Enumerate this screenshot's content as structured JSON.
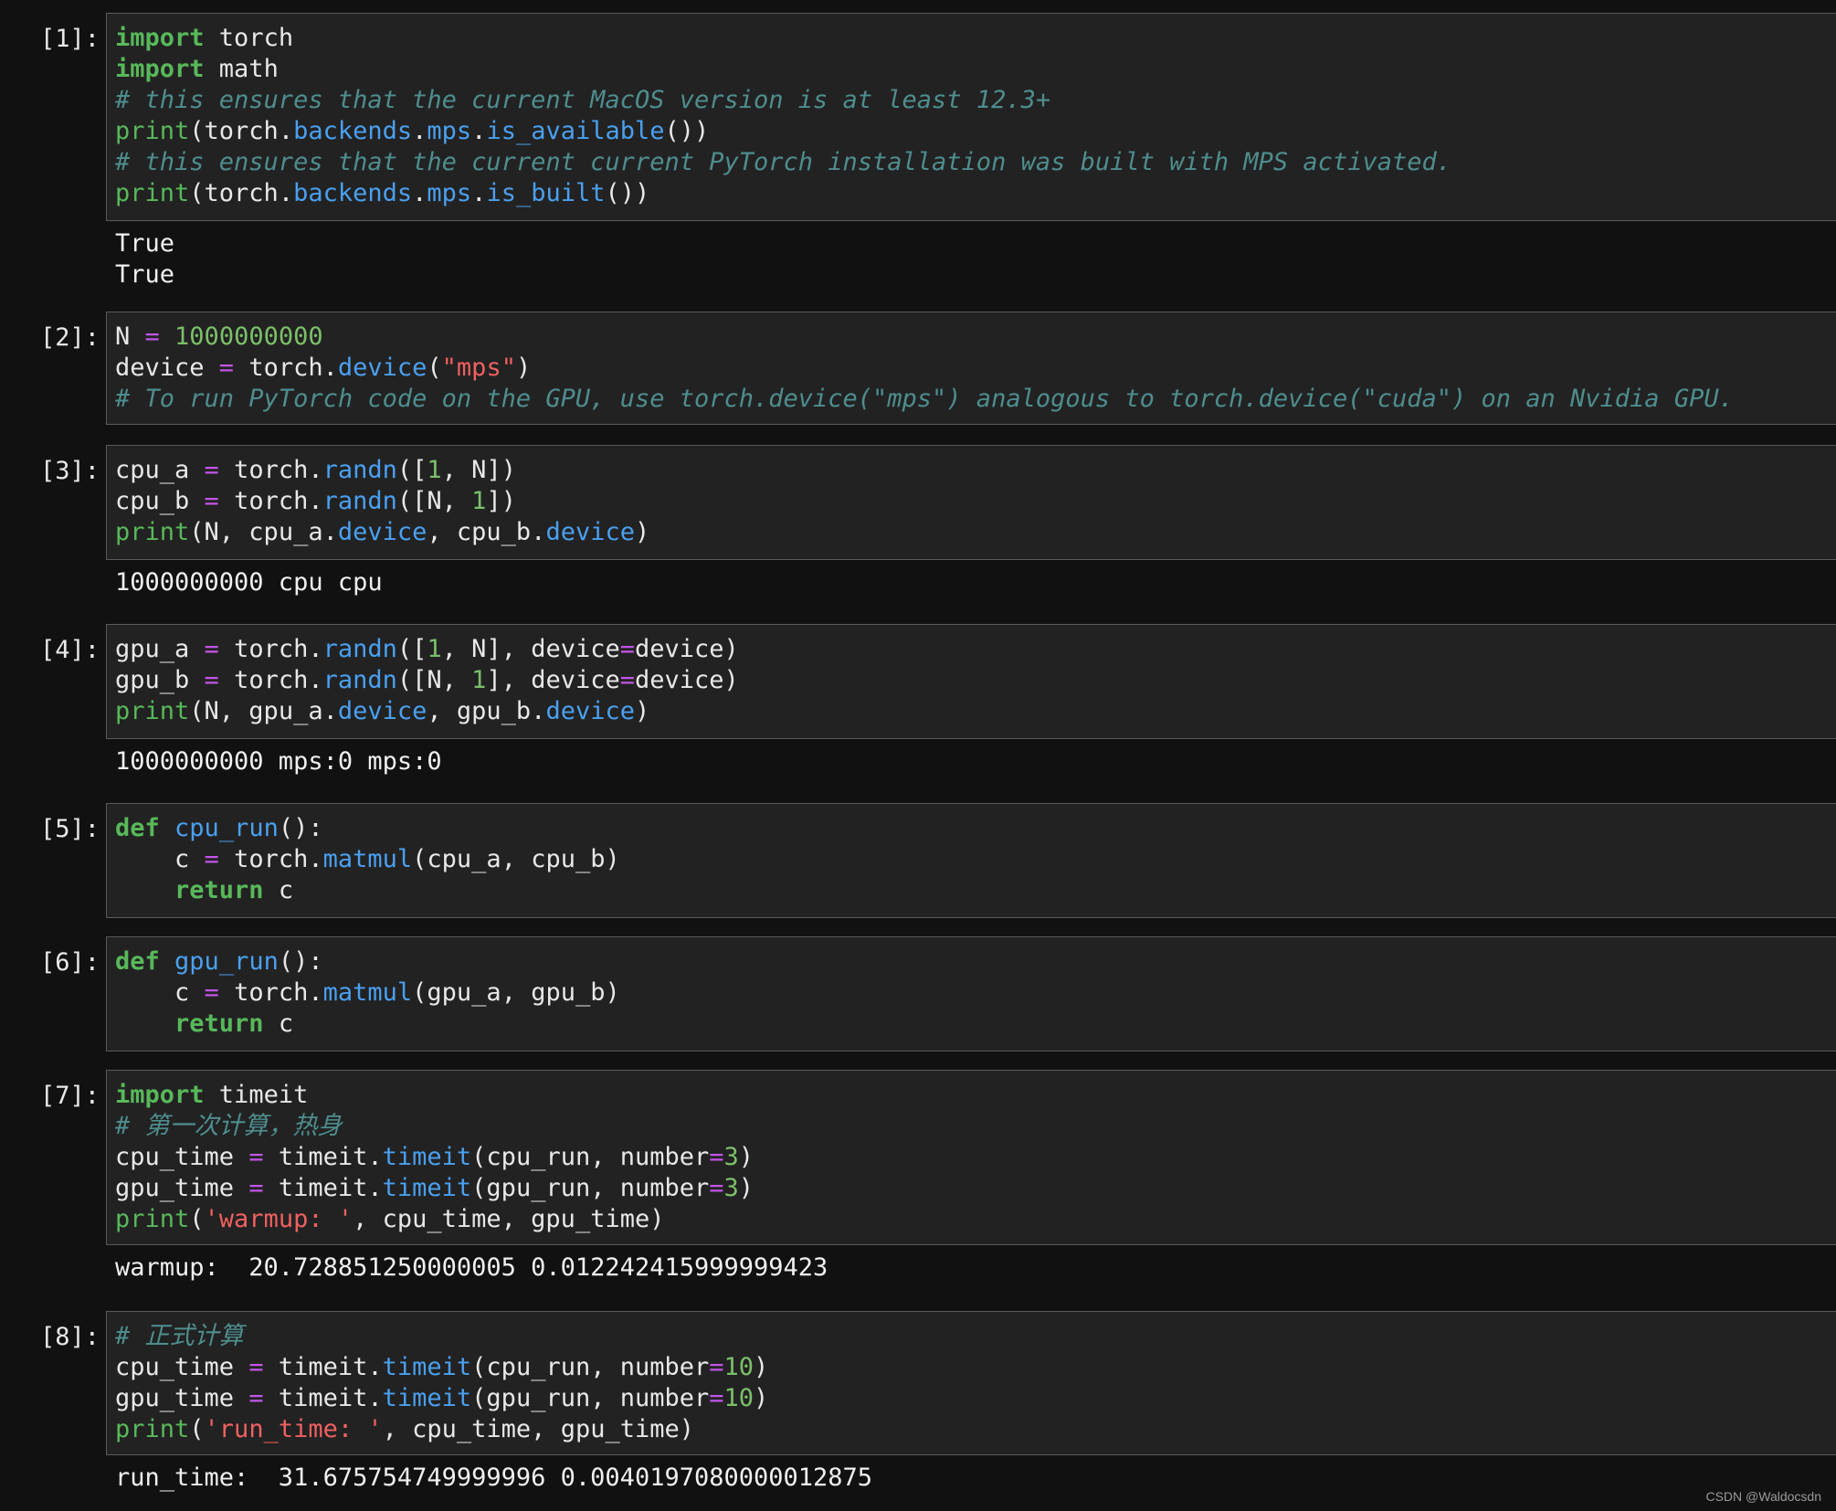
{
  "notebook": {
    "cells": [
      {
        "prompt": "[1]:",
        "code": [
          [
            [
              "kw",
              "import"
            ],
            [
              "t",
              " torch"
            ]
          ],
          [
            [
              "kw",
              "import"
            ],
            [
              "t",
              " math"
            ]
          ],
          [
            [
              "cm",
              "# this ensures that the current MacOS version is at least 12.3+"
            ]
          ],
          [
            [
              "bi",
              "print"
            ],
            [
              "t",
              "(torch."
            ],
            [
              "at",
              "backends"
            ],
            [
              "t",
              "."
            ],
            [
              "at",
              "mps"
            ],
            [
              "t",
              "."
            ],
            [
              "at",
              "is_available"
            ],
            [
              "t",
              "())"
            ]
          ],
          [
            [
              "cm",
              "# this ensures that the current current PyTorch installation was built with MPS activated."
            ]
          ],
          [
            [
              "bi",
              "print"
            ],
            [
              "t",
              "(torch."
            ],
            [
              "at",
              "backends"
            ],
            [
              "t",
              "."
            ],
            [
              "at",
              "mps"
            ],
            [
              "t",
              "."
            ],
            [
              "at",
              "is_built"
            ],
            [
              "t",
              "())"
            ]
          ]
        ],
        "output": [
          "True",
          "True"
        ]
      },
      {
        "prompt": "[2]:",
        "code": [
          [
            [
              "t",
              "N "
            ],
            [
              "op",
              "="
            ],
            [
              "t",
              " "
            ],
            [
              "nm",
              "1000000000"
            ]
          ],
          [
            [
              "t",
              "device "
            ],
            [
              "op",
              "="
            ],
            [
              "t",
              " torch."
            ],
            [
              "at",
              "device"
            ],
            [
              "t",
              "("
            ],
            [
              "st",
              "\"mps\""
            ],
            [
              "t",
              ")"
            ]
          ],
          [
            [
              "cm",
              "# To run PyTorch code on the GPU, use torch.device(\"mps\") analogous to torch.device(\"cuda\") on an Nvidia GPU."
            ]
          ]
        ],
        "output": []
      },
      {
        "prompt": "[3]:",
        "code": [
          [
            [
              "t",
              "cpu_a "
            ],
            [
              "op",
              "="
            ],
            [
              "t",
              " torch."
            ],
            [
              "at",
              "randn"
            ],
            [
              "t",
              "(["
            ],
            [
              "nm",
              "1"
            ],
            [
              "t",
              ", N])"
            ]
          ],
          [
            [
              "t",
              "cpu_b "
            ],
            [
              "op",
              "="
            ],
            [
              "t",
              " torch."
            ],
            [
              "at",
              "randn"
            ],
            [
              "t",
              "([N, "
            ],
            [
              "nm",
              "1"
            ],
            [
              "t",
              "])"
            ]
          ],
          [
            [
              "bi",
              "print"
            ],
            [
              "t",
              "(N, cpu_a."
            ],
            [
              "at",
              "device"
            ],
            [
              "t",
              ", cpu_b."
            ],
            [
              "at",
              "device"
            ],
            [
              "t",
              ")"
            ]
          ]
        ],
        "output": [
          "1000000000 cpu cpu"
        ]
      },
      {
        "prompt": "[4]:",
        "code": [
          [
            [
              "t",
              "gpu_a "
            ],
            [
              "op",
              "="
            ],
            [
              "t",
              " torch."
            ],
            [
              "at",
              "randn"
            ],
            [
              "t",
              "(["
            ],
            [
              "nm",
              "1"
            ],
            [
              "t",
              ", N], device"
            ],
            [
              "op",
              "="
            ],
            [
              "t",
              "device)"
            ]
          ],
          [
            [
              "t",
              "gpu_b "
            ],
            [
              "op",
              "="
            ],
            [
              "t",
              " torch."
            ],
            [
              "at",
              "randn"
            ],
            [
              "t",
              "([N, "
            ],
            [
              "nm",
              "1"
            ],
            [
              "t",
              "], device"
            ],
            [
              "op",
              "="
            ],
            [
              "t",
              "device)"
            ]
          ],
          [
            [
              "bi",
              "print"
            ],
            [
              "t",
              "(N, gpu_a."
            ],
            [
              "at",
              "device"
            ],
            [
              "t",
              ", gpu_b."
            ],
            [
              "at",
              "device"
            ],
            [
              "t",
              ")"
            ]
          ]
        ],
        "output": [
          "1000000000 mps:0 mps:0"
        ]
      },
      {
        "prompt": "[5]:",
        "code": [
          [
            [
              "kw",
              "def"
            ],
            [
              "t",
              " "
            ],
            [
              "fn",
              "cpu_run"
            ],
            [
              "t",
              "():"
            ]
          ],
          [
            [
              "t",
              "    c "
            ],
            [
              "op",
              "="
            ],
            [
              "t",
              " torch."
            ],
            [
              "at",
              "matmul"
            ],
            [
              "t",
              "(cpu_a, cpu_b)"
            ]
          ],
          [
            [
              "t",
              "    "
            ],
            [
              "kw",
              "return"
            ],
            [
              "t",
              " c"
            ]
          ]
        ],
        "output": []
      },
      {
        "prompt": "[6]:",
        "code": [
          [
            [
              "kw",
              "def"
            ],
            [
              "t",
              " "
            ],
            [
              "fn",
              "gpu_run"
            ],
            [
              "t",
              "():"
            ]
          ],
          [
            [
              "t",
              "    c "
            ],
            [
              "op",
              "="
            ],
            [
              "t",
              " torch."
            ],
            [
              "at",
              "matmul"
            ],
            [
              "t",
              "(gpu_a, gpu_b)"
            ]
          ],
          [
            [
              "t",
              "    "
            ],
            [
              "kw",
              "return"
            ],
            [
              "t",
              " c"
            ]
          ]
        ],
        "output": []
      },
      {
        "prompt": "[7]:",
        "code": [
          [
            [
              "kw",
              "import"
            ],
            [
              "t",
              " timeit"
            ]
          ],
          [
            [
              "cm",
              "# 第一次计算，热身"
            ]
          ],
          [
            [
              "t",
              "cpu_time "
            ],
            [
              "op",
              "="
            ],
            [
              "t",
              " timeit."
            ],
            [
              "at",
              "timeit"
            ],
            [
              "t",
              "(cpu_run, number"
            ],
            [
              "op",
              "="
            ],
            [
              "nm",
              "3"
            ],
            [
              "t",
              ")"
            ]
          ],
          [
            [
              "t",
              "gpu_time "
            ],
            [
              "op",
              "="
            ],
            [
              "t",
              " timeit."
            ],
            [
              "at",
              "timeit"
            ],
            [
              "t",
              "(gpu_run, number"
            ],
            [
              "op",
              "="
            ],
            [
              "nm",
              "3"
            ],
            [
              "t",
              ")"
            ]
          ],
          [
            [
              "bi",
              "print"
            ],
            [
              "t",
              "("
            ],
            [
              "st",
              "'warmup: '"
            ],
            [
              "t",
              ", cpu_time, gpu_time)"
            ]
          ]
        ],
        "output": [
          "warmup:  20.728851250000005 0.012242415999999423"
        ]
      },
      {
        "prompt": "[8]:",
        "code": [
          [
            [
              "cm",
              "# 正式计算"
            ]
          ],
          [
            [
              "t",
              "cpu_time "
            ],
            [
              "op",
              "="
            ],
            [
              "t",
              " timeit."
            ],
            [
              "at",
              "timeit"
            ],
            [
              "t",
              "(cpu_run, number"
            ],
            [
              "op",
              "="
            ],
            [
              "nm",
              "10"
            ],
            [
              "t",
              ")"
            ]
          ],
          [
            [
              "t",
              "gpu_time "
            ],
            [
              "op",
              "="
            ],
            [
              "t",
              " timeit."
            ],
            [
              "at",
              "timeit"
            ],
            [
              "t",
              "(gpu_run, number"
            ],
            [
              "op",
              "="
            ],
            [
              "nm",
              "10"
            ],
            [
              "t",
              ")"
            ]
          ],
          [
            [
              "bi",
              "print"
            ],
            [
              "t",
              "("
            ],
            [
              "st",
              "'run_time: '"
            ],
            [
              "t",
              ", cpu_time, gpu_time)"
            ]
          ]
        ],
        "output": [
          "run_time:  31.675754749999996 0.0040197080000012875"
        ]
      }
    ]
  },
  "watermark": "CSDN @Waldocsdn",
  "colors": {
    "background": "#111111",
    "cell_background": "#222222",
    "cell_border": "#5a5a5a",
    "keyword": "#58b85a",
    "attribute": "#4aa0f0",
    "operator": "#c355e8",
    "number": "#7cbf6a",
    "string": "#f06060",
    "comment": "#4f8d8d"
  }
}
